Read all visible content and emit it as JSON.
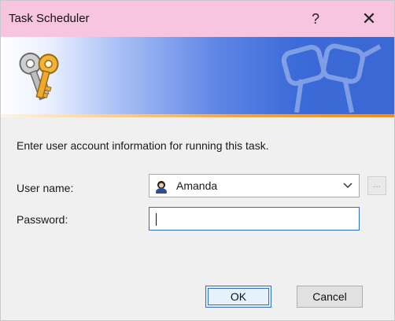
{
  "window": {
    "title": "Task Scheduler",
    "help_glyph": "?",
    "close_glyph": "✕"
  },
  "colors": {
    "titlebar_bg": "#f8c5e0",
    "banner_blue": "#3b6bd8",
    "accent_orange": "#f28a1a",
    "focus_blue": "#2b6cd8"
  },
  "banner": {
    "logo_icon": "keys-icon",
    "watermark_icon": "keys-watermark-icon"
  },
  "form": {
    "instructions": "Enter user account information for running this task.",
    "user_label": "User name:",
    "user_value": "Amanda",
    "user_icon": "user-avatar-icon",
    "browse_label": "...",
    "password_label": "Password:",
    "password_value": ""
  },
  "buttons": {
    "ok": "OK",
    "cancel": "Cancel"
  }
}
